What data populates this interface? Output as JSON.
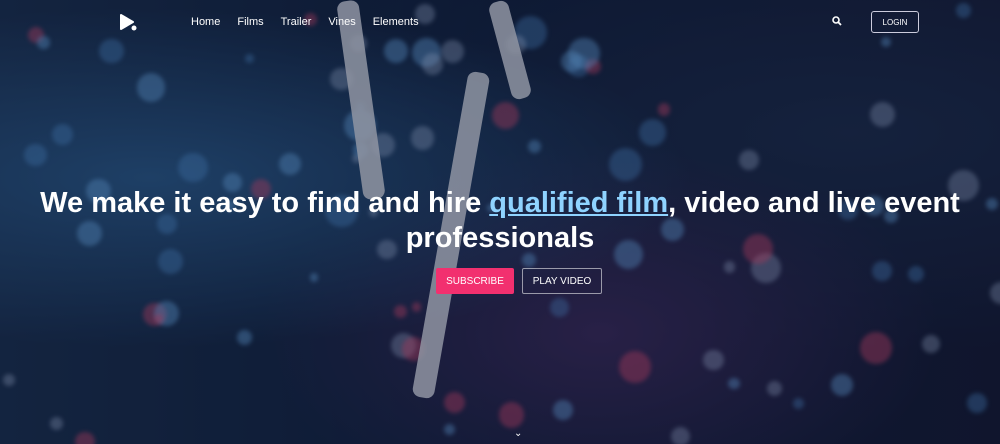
{
  "nav": {
    "items": [
      "Home",
      "Films",
      "Trailer",
      "Vines",
      "Elements"
    ],
    "login": "LOGIN"
  },
  "hero": {
    "title_before": "We make it easy to find and hire ",
    "title_link": "qualified film",
    "title_after": ", video and live event professionals",
    "subscribe": "SUBSCRIBE",
    "play": "PLAY VIDEO"
  },
  "colors": {
    "accent": "#f2306f",
    "link": "#8fd3ff"
  }
}
